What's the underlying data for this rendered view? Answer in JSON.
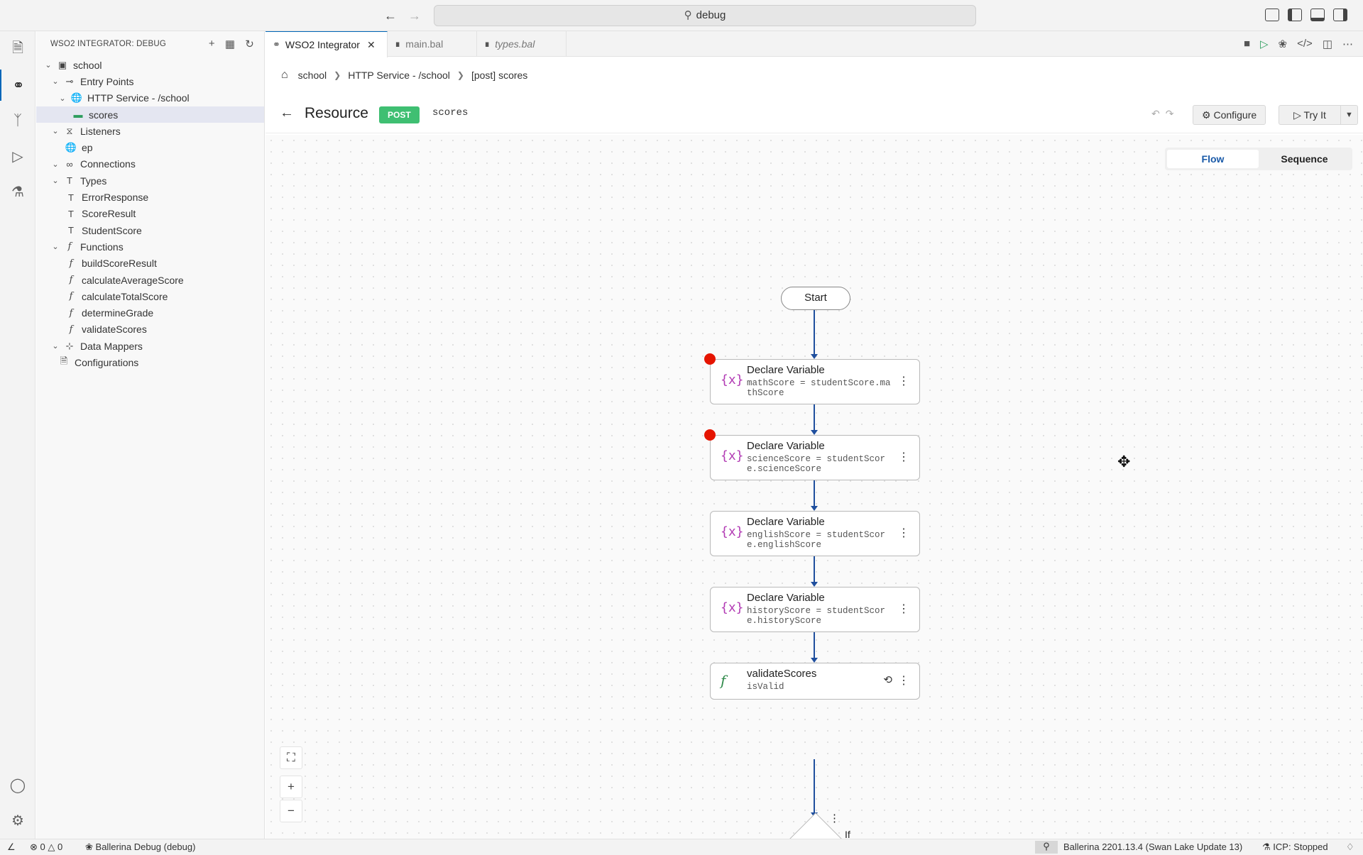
{
  "titlebar": {
    "search_text": "debug",
    "back_icon": "arrow-left-icon",
    "forward_icon": "arrow-right-icon"
  },
  "sidebar": {
    "title": "WSO2 INTEGRATOR: DEBUG",
    "tree": [
      {
        "label": "school",
        "icon": "package-icon",
        "indent": 0,
        "chevron": "down"
      },
      {
        "label": "Entry Points",
        "icon": "entry-icon",
        "indent": 1,
        "chevron": "down"
      },
      {
        "label": "HTTP Service - /school",
        "icon": "globe-icon",
        "indent": 2,
        "chevron": "down"
      },
      {
        "label": "scores",
        "icon": "resource-icon",
        "indent": 3,
        "chevron": "",
        "selected": true
      },
      {
        "label": "Listeners",
        "icon": "broadcast-icon",
        "indent": 1,
        "chevron": "down"
      },
      {
        "label": "ep",
        "icon": "globe-icon",
        "indent": 2,
        "chevron": ""
      },
      {
        "label": "Connections",
        "icon": "link-icon",
        "indent": 1,
        "chevron": "down"
      },
      {
        "label": "Types",
        "icon": "type-icon",
        "indent": 1,
        "chevron": "down"
      },
      {
        "label": "ErrorResponse",
        "icon": "type-icon",
        "indent": 2,
        "chevron": ""
      },
      {
        "label": "ScoreResult",
        "icon": "type-icon",
        "indent": 2,
        "chevron": ""
      },
      {
        "label": "StudentScore",
        "icon": "type-icon",
        "indent": 2,
        "chevron": ""
      },
      {
        "label": "Functions",
        "icon": "function-icon",
        "indent": 1,
        "chevron": "down"
      },
      {
        "label": "buildScoreResult",
        "icon": "function-icon",
        "indent": 2,
        "chevron": ""
      },
      {
        "label": "calculateAverageScore",
        "icon": "function-icon",
        "indent": 2,
        "chevron": ""
      },
      {
        "label": "calculateTotalScore",
        "icon": "function-icon",
        "indent": 2,
        "chevron": ""
      },
      {
        "label": "determineGrade",
        "icon": "function-icon",
        "indent": 2,
        "chevron": ""
      },
      {
        "label": "validateScores",
        "icon": "function-icon",
        "indent": 2,
        "chevron": ""
      },
      {
        "label": "Data Mappers",
        "icon": "mapper-icon",
        "indent": 1,
        "chevron": "down"
      },
      {
        "label": "Configurations",
        "icon": "file-icon",
        "indent": 1,
        "chevron": ""
      }
    ]
  },
  "tabs": [
    {
      "label": "WSO2 Integrator",
      "active": true,
      "closable": true,
      "italic": false
    },
    {
      "label": "main.bal",
      "active": false,
      "closable": false,
      "italic": false
    },
    {
      "label": "types.bal",
      "active": false,
      "closable": false,
      "italic": true
    }
  ],
  "breadcrumb": [
    "school",
    "HTTP Service - /school",
    "[post] scores"
  ],
  "resource": {
    "title": "Resource",
    "method": "POST",
    "path": "scores",
    "configure_label": "Configure",
    "tryit_label": "Try It"
  },
  "view_toggle": {
    "flow": "Flow",
    "sequence": "Sequence",
    "selected": "Flow"
  },
  "flow": {
    "start_label": "Start",
    "nodes": [
      {
        "title": "Declare Variable",
        "expr": "mathScore = studentScore.mathScore",
        "icon": "variable-icon",
        "breakpoint": true
      },
      {
        "title": "Declare Variable",
        "expr": "scienceScore = studentScore.scienceScore",
        "icon": "variable-icon",
        "breakpoint": true
      },
      {
        "title": "Declare Variable",
        "expr": "englishScore = studentScore.englishScore",
        "icon": "variable-icon",
        "breakpoint": false
      },
      {
        "title": "Declare Variable",
        "expr": "historyScore = studentScore.historyScore",
        "icon": "variable-icon",
        "breakpoint": false
      },
      {
        "title": "validateScores",
        "expr": "isValid",
        "icon": "function-icon",
        "breakpoint": false
      }
    ],
    "if_label": "If"
  },
  "statusbar": {
    "errors": "0",
    "warnings": "0",
    "debug_label": "Ballerina Debug (debug)",
    "version": "Ballerina 2201.13.4 (Swan Lake Update 13)",
    "icp": "ICP: Stopped"
  },
  "colors": {
    "accent": "#0066b8",
    "post_badge": "#3fbf72",
    "edge": "#1f4f9e",
    "breakpoint": "#e51400",
    "variable_icon": "#b23bb4"
  }
}
